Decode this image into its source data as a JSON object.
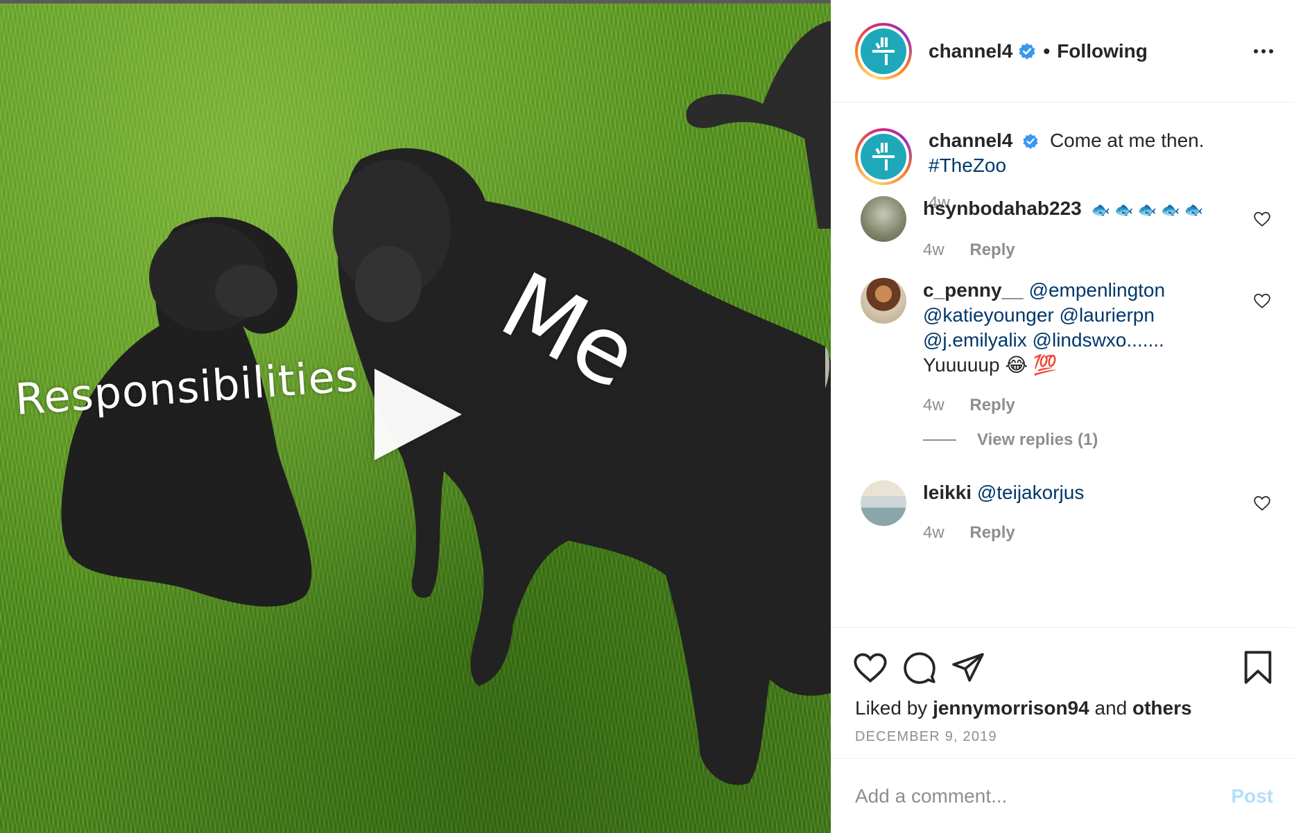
{
  "media": {
    "overlay_left": "Responsibilities",
    "overlay_right": "Me"
  },
  "header": {
    "username": "channel4",
    "separator": "•",
    "follow_status": "Following"
  },
  "caption": {
    "username": "channel4",
    "text": "Come at me then.",
    "hashtag": "#TheZoo",
    "age": "4w"
  },
  "comments": [
    {
      "username": "hsynbodahab223",
      "text": "🐟 🐟 🐟 🐟 🐟",
      "age": "4w",
      "reply_label": "Reply"
    },
    {
      "username": "c_penny__",
      "mentions_line1": "@empenlington",
      "mentions_line2": "@katieyounger @laurierpn",
      "mentions_line3": "@j.emilyalix @lindswxo.......",
      "text_end": "Yuuuuup 😂 💯",
      "age": "4w",
      "reply_label": "Reply",
      "view_replies": "View replies (1)"
    },
    {
      "username": "leikki",
      "mention": "@teijakorjus",
      "age": "4w",
      "reply_label": "Reply"
    }
  ],
  "likes": {
    "prefix": "Liked by",
    "user": "jennymorrison94",
    "middle": "and",
    "suffix": "others"
  },
  "date": "DECEMBER 9, 2019",
  "add_comment": {
    "placeholder": "Add a comment...",
    "post_label": "Post"
  },
  "colors": {
    "brand_teal": "#1fa8b9",
    "verified_blue": "#3897f0",
    "mention_blue": "#00376b",
    "post_disabled": "#b2dffc"
  }
}
